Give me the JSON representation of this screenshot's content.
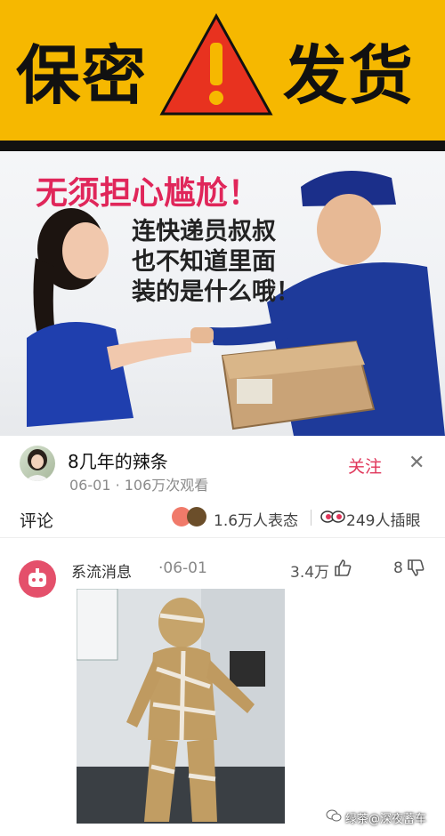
{
  "banner": {
    "left_text": "保密",
    "right_text": "发货",
    "bg_color": "#f6b800"
  },
  "ad": {
    "headline": "无须担心尴尬！",
    "lines": [
      "连快递员叔叔",
      "也不知道里面",
      "装的是什么哦！"
    ],
    "headline_color": "#e0265a"
  },
  "post": {
    "username": "8几年的辣条",
    "meta": "06-01 · 106万次观看",
    "follow_label": "关注",
    "close_icon": "close-icon"
  },
  "stats": {
    "comment_label": "评论",
    "reactions": "1.6万人表态",
    "inserts": "249人插眼"
  },
  "comment": {
    "user": "系流消息",
    "date": "·06-01",
    "likes": "3.4万",
    "dislikes": "8"
  },
  "watermark": "绿茶@深夜蓄车",
  "colors": {
    "accent_pink": "#e0365a",
    "banner_yellow": "#f6b800"
  }
}
